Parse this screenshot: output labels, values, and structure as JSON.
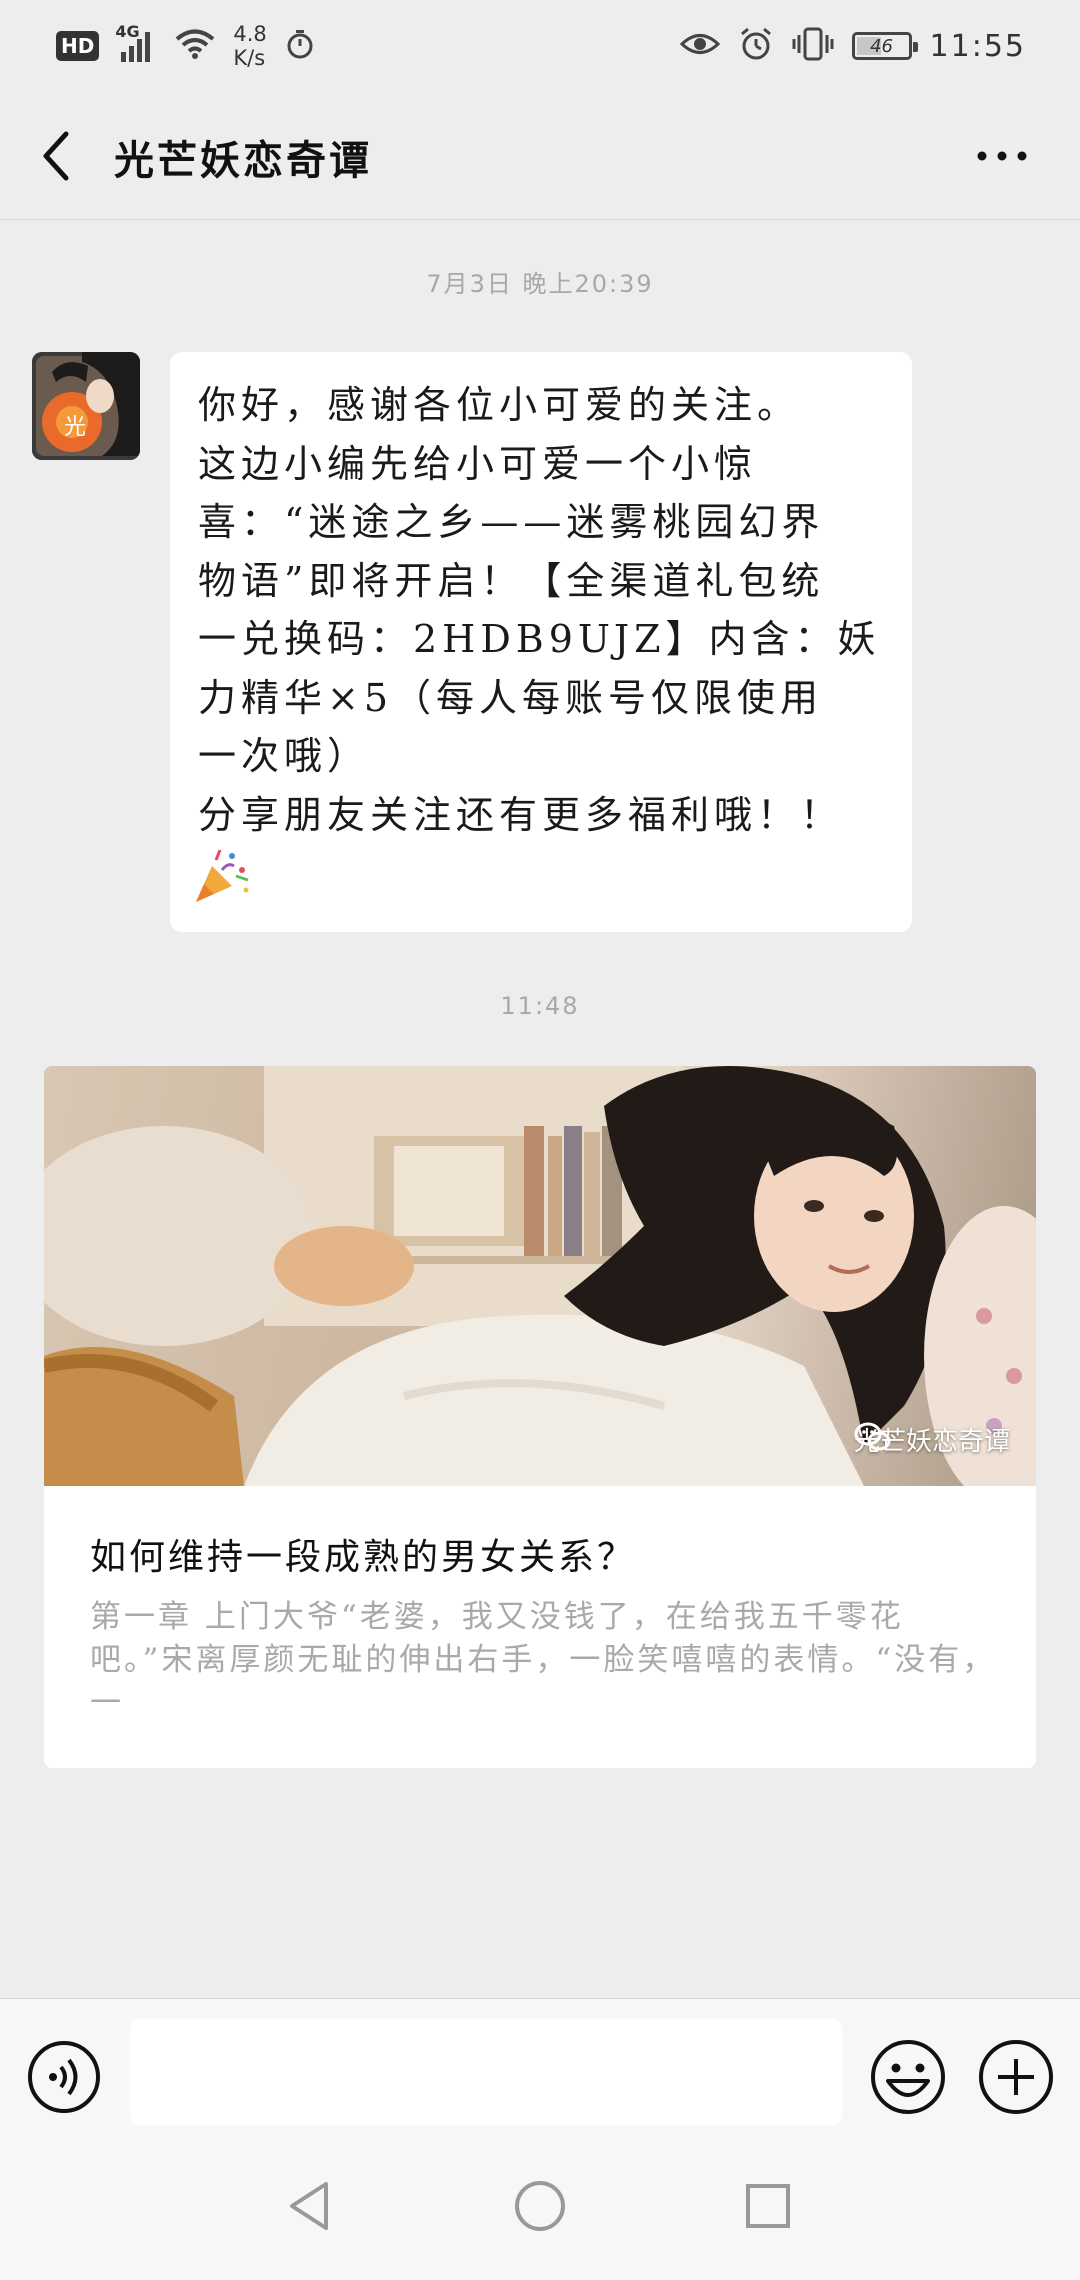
{
  "status_bar": {
    "hd": "HD",
    "network": "4G",
    "speed_value": "4.8",
    "speed_unit": "K/s",
    "battery": "46",
    "time": "11:55"
  },
  "header": {
    "title": "光芒妖恋奇谭"
  },
  "messages": {
    "timestamp_1": "7月3日 晚上20:39",
    "text_1": "你好，感谢各位小可爱的关注。\n这边小编先给小可爱一个小惊\n喜：“迷途之乡——迷雾桃园幻界\n物语”即将开启！【全渠道礼包统\n一兑换码：2HDB9UJZ】内含：妖\n力精华×5（每人每账号仅限使用\n一次哦）\n分享朋友关注还有更多福利哦！！",
    "emoji_1": "party-popper",
    "timestamp_2": "11:48"
  },
  "article": {
    "watermark": "光芒妖恋奇谭",
    "title": "如何维持一段成熟的男女关系？",
    "excerpt": "第一章 上门大爷“老婆，我又没钱了，在给我五千零花吧。”宋离厚颜无耻的伸出右手，一脸笑嘻嘻的表情。“没有，一"
  },
  "input": {
    "placeholder": ""
  },
  "colors": {
    "background": "#ededed",
    "bubble": "#ffffff",
    "muted_text": "#a9a9a9"
  }
}
